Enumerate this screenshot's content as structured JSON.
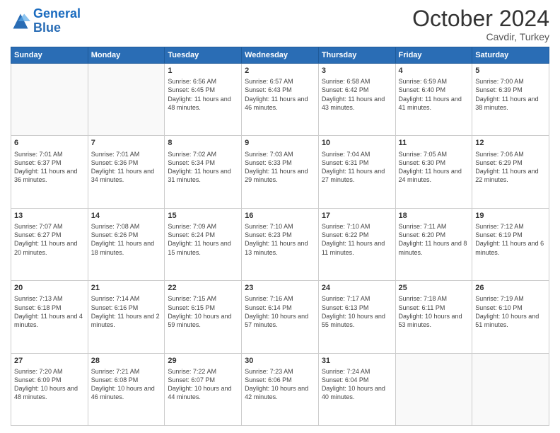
{
  "logo": {
    "line1": "General",
    "line2": "Blue"
  },
  "title": "October 2024",
  "location": "Cavdir, Turkey",
  "header_days": [
    "Sunday",
    "Monday",
    "Tuesday",
    "Wednesday",
    "Thursday",
    "Friday",
    "Saturday"
  ],
  "weeks": [
    [
      {
        "day": "",
        "info": ""
      },
      {
        "day": "",
        "info": ""
      },
      {
        "day": "1",
        "info": "Sunrise: 6:56 AM\nSunset: 6:45 PM\nDaylight: 11 hours and 48 minutes."
      },
      {
        "day": "2",
        "info": "Sunrise: 6:57 AM\nSunset: 6:43 PM\nDaylight: 11 hours and 46 minutes."
      },
      {
        "day": "3",
        "info": "Sunrise: 6:58 AM\nSunset: 6:42 PM\nDaylight: 11 hours and 43 minutes."
      },
      {
        "day": "4",
        "info": "Sunrise: 6:59 AM\nSunset: 6:40 PM\nDaylight: 11 hours and 41 minutes."
      },
      {
        "day": "5",
        "info": "Sunrise: 7:00 AM\nSunset: 6:39 PM\nDaylight: 11 hours and 38 minutes."
      }
    ],
    [
      {
        "day": "6",
        "info": "Sunrise: 7:01 AM\nSunset: 6:37 PM\nDaylight: 11 hours and 36 minutes."
      },
      {
        "day": "7",
        "info": "Sunrise: 7:01 AM\nSunset: 6:36 PM\nDaylight: 11 hours and 34 minutes."
      },
      {
        "day": "8",
        "info": "Sunrise: 7:02 AM\nSunset: 6:34 PM\nDaylight: 11 hours and 31 minutes."
      },
      {
        "day": "9",
        "info": "Sunrise: 7:03 AM\nSunset: 6:33 PM\nDaylight: 11 hours and 29 minutes."
      },
      {
        "day": "10",
        "info": "Sunrise: 7:04 AM\nSunset: 6:31 PM\nDaylight: 11 hours and 27 minutes."
      },
      {
        "day": "11",
        "info": "Sunrise: 7:05 AM\nSunset: 6:30 PM\nDaylight: 11 hours and 24 minutes."
      },
      {
        "day": "12",
        "info": "Sunrise: 7:06 AM\nSunset: 6:29 PM\nDaylight: 11 hours and 22 minutes."
      }
    ],
    [
      {
        "day": "13",
        "info": "Sunrise: 7:07 AM\nSunset: 6:27 PM\nDaylight: 11 hours and 20 minutes."
      },
      {
        "day": "14",
        "info": "Sunrise: 7:08 AM\nSunset: 6:26 PM\nDaylight: 11 hours and 18 minutes."
      },
      {
        "day": "15",
        "info": "Sunrise: 7:09 AM\nSunset: 6:24 PM\nDaylight: 11 hours and 15 minutes."
      },
      {
        "day": "16",
        "info": "Sunrise: 7:10 AM\nSunset: 6:23 PM\nDaylight: 11 hours and 13 minutes."
      },
      {
        "day": "17",
        "info": "Sunrise: 7:10 AM\nSunset: 6:22 PM\nDaylight: 11 hours and 11 minutes."
      },
      {
        "day": "18",
        "info": "Sunrise: 7:11 AM\nSunset: 6:20 PM\nDaylight: 11 hours and 8 minutes."
      },
      {
        "day": "19",
        "info": "Sunrise: 7:12 AM\nSunset: 6:19 PM\nDaylight: 11 hours and 6 minutes."
      }
    ],
    [
      {
        "day": "20",
        "info": "Sunrise: 7:13 AM\nSunset: 6:18 PM\nDaylight: 11 hours and 4 minutes."
      },
      {
        "day": "21",
        "info": "Sunrise: 7:14 AM\nSunset: 6:16 PM\nDaylight: 11 hours and 2 minutes."
      },
      {
        "day": "22",
        "info": "Sunrise: 7:15 AM\nSunset: 6:15 PM\nDaylight: 10 hours and 59 minutes."
      },
      {
        "day": "23",
        "info": "Sunrise: 7:16 AM\nSunset: 6:14 PM\nDaylight: 10 hours and 57 minutes."
      },
      {
        "day": "24",
        "info": "Sunrise: 7:17 AM\nSunset: 6:13 PM\nDaylight: 10 hours and 55 minutes."
      },
      {
        "day": "25",
        "info": "Sunrise: 7:18 AM\nSunset: 6:11 PM\nDaylight: 10 hours and 53 minutes."
      },
      {
        "day": "26",
        "info": "Sunrise: 7:19 AM\nSunset: 6:10 PM\nDaylight: 10 hours and 51 minutes."
      }
    ],
    [
      {
        "day": "27",
        "info": "Sunrise: 7:20 AM\nSunset: 6:09 PM\nDaylight: 10 hours and 48 minutes."
      },
      {
        "day": "28",
        "info": "Sunrise: 7:21 AM\nSunset: 6:08 PM\nDaylight: 10 hours and 46 minutes."
      },
      {
        "day": "29",
        "info": "Sunrise: 7:22 AM\nSunset: 6:07 PM\nDaylight: 10 hours and 44 minutes."
      },
      {
        "day": "30",
        "info": "Sunrise: 7:23 AM\nSunset: 6:06 PM\nDaylight: 10 hours and 42 minutes."
      },
      {
        "day": "31",
        "info": "Sunrise: 7:24 AM\nSunset: 6:04 PM\nDaylight: 10 hours and 40 minutes."
      },
      {
        "day": "",
        "info": ""
      },
      {
        "day": "",
        "info": ""
      }
    ]
  ]
}
